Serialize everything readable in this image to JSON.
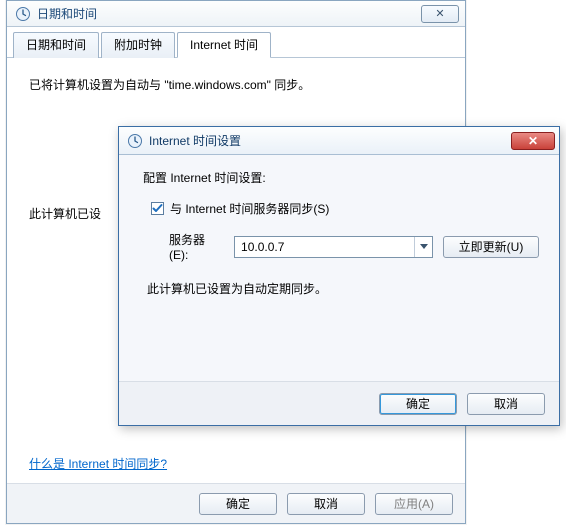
{
  "win1": {
    "title": "日期和时间",
    "close_glyph": "✕",
    "tabs": [
      {
        "label": "日期和时间"
      },
      {
        "label": "附加时钟"
      },
      {
        "label": "Internet 时间"
      }
    ],
    "sync_text_full": "已将计算机设置为自动与 \"time.windows.com\" 同步。",
    "status_text_trunc": "此计算机已设",
    "help_link": "什么是 Internet 时间同步?",
    "footer": {
      "ok": "确定",
      "cancel": "取消",
      "apply": "应用(A)"
    }
  },
  "win2": {
    "title": "Internet 时间设置",
    "close_glyph": "✕",
    "heading": "配置 Internet 时间设置:",
    "checkbox_label": "与 Internet 时间服务器同步(S)",
    "checkbox_checked": true,
    "server_label": "服务器(E):",
    "server_value": "10.0.0.7",
    "update_btn": "立即更新(U)",
    "status": "此计算机已设置为自动定期同步。",
    "footer": {
      "ok": "确定",
      "cancel": "取消"
    }
  }
}
